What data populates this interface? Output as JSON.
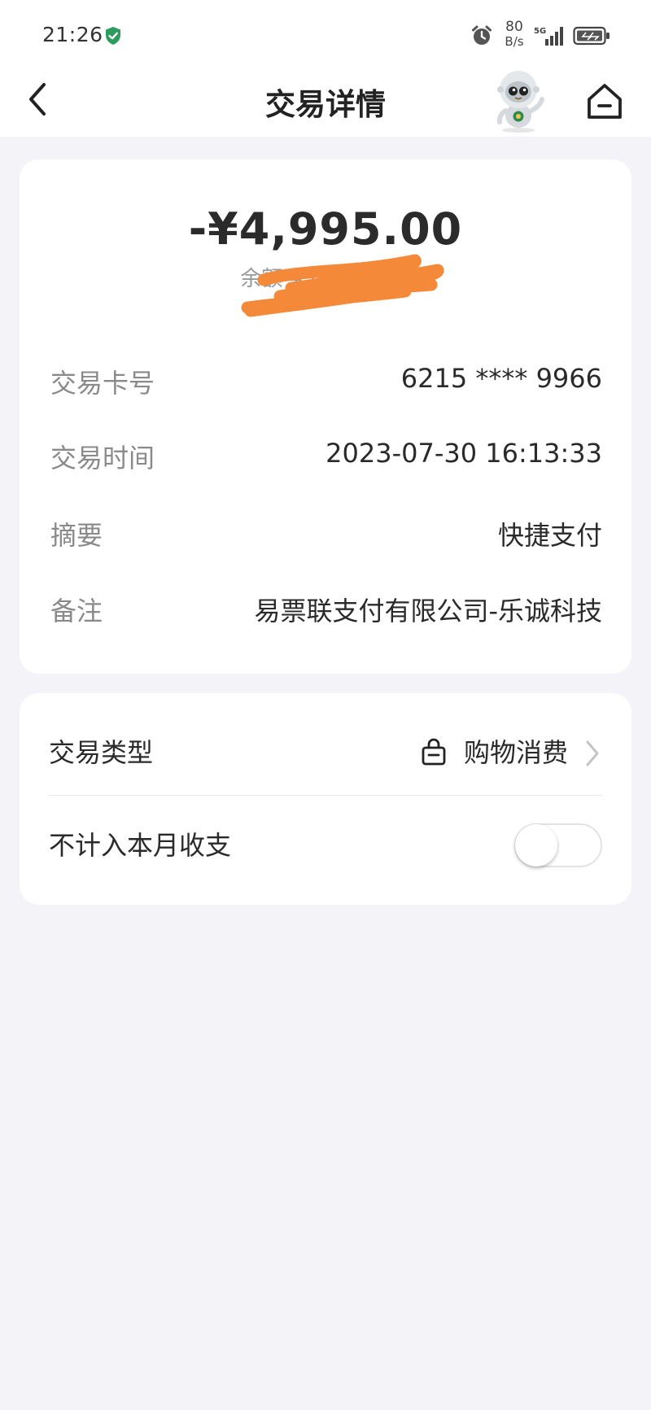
{
  "status_bar": {
    "time": "21:26",
    "net_speed_value": "80",
    "net_speed_unit": "B/s",
    "network_type": "5G",
    "icons": [
      "shield-check-icon",
      "alarm-icon",
      "signal-icon",
      "battery-icon"
    ]
  },
  "nav": {
    "title": "交易详情",
    "back_icon": "chevron-left-icon",
    "home_icon": "home-icon"
  },
  "transaction": {
    "amount": "-¥4,995.00",
    "balance_text": "余额 ¥54,829.10",
    "fields": [
      {
        "label": "交易卡号",
        "value": "6215 **** 9966"
      },
      {
        "label": "交易时间",
        "value": "2023-07-30 16:13:33"
      },
      {
        "label": "摘要",
        "value": "快捷支付"
      },
      {
        "label": "备注",
        "value": "易票联支付有限公司-乐诚科技"
      }
    ]
  },
  "category": {
    "label": "交易类型",
    "value": "购物消费",
    "icon": "shopping-bag-icon"
  },
  "exclude": {
    "label": "不计入本月收支",
    "enabled": false
  },
  "colors": {
    "page_bg": "#f4f3f8",
    "card_bg": "#ffffff",
    "redaction": "#f5893a",
    "secure_green": "#2e9c5e"
  }
}
